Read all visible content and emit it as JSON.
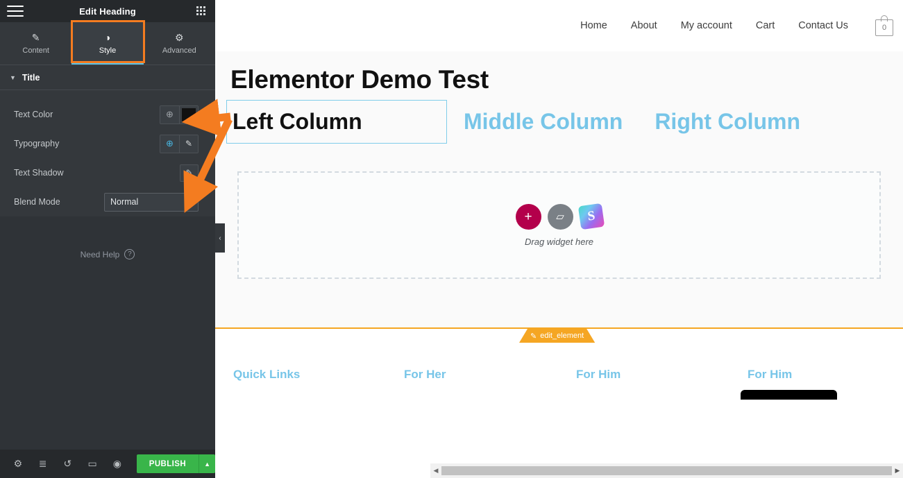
{
  "panel": {
    "header": {
      "title": "Edit Heading",
      "menu_icon": "hamburger-icon",
      "grid_icon": "widgets-grid-icon"
    },
    "tabs": [
      {
        "label": "Content",
        "icon": "pencil-icon",
        "glyph": "✎",
        "active": false
      },
      {
        "label": "Style",
        "icon": "half-circle-contrast-icon",
        "glyph": "◑",
        "active": true
      },
      {
        "label": "Advanced",
        "icon": "gear-icon",
        "glyph": "⚙",
        "active": false
      }
    ],
    "section": {
      "label": "Title",
      "caret": "▼"
    },
    "controls": [
      {
        "label": "Text Color",
        "globe": "⊕",
        "swatch_color": "#111111"
      },
      {
        "label": "Typography",
        "globe": "⊕",
        "pencil": "✎"
      },
      {
        "label": "Text Shadow",
        "pencil": "✎"
      },
      {
        "label": "Blend Mode",
        "value": "Normal",
        "caret": "▼"
      }
    ],
    "need_help": {
      "label": "Need Help",
      "badge": "?"
    },
    "footer": {
      "icons": [
        {
          "name": "settings-icon",
          "glyph": "⚙"
        },
        {
          "name": "navigator-layers-icon",
          "glyph": "≣"
        },
        {
          "name": "history-icon",
          "glyph": "↺"
        },
        {
          "name": "responsive-mode-icon",
          "glyph": "▭"
        },
        {
          "name": "preview-eye-icon",
          "glyph": "◉"
        }
      ],
      "publish_label": "PUBLISH",
      "publish_caret": "▲",
      "publish_color": "#39b54a"
    },
    "collapse_caret": "‹"
  },
  "site": {
    "nav": [
      {
        "label": "Home"
      },
      {
        "label": "About"
      },
      {
        "label": "My account"
      },
      {
        "label": "Cart"
      },
      {
        "label": "Contact Us"
      }
    ],
    "cart_count": "0",
    "heading": "Elementor Demo Test",
    "columns": [
      {
        "label": "Left Column",
        "color": "#111111",
        "selected": true
      },
      {
        "label": "Middle Column",
        "color": "#77c5e8",
        "selected": false
      },
      {
        "label": "Right Column",
        "color": "#77c5e8",
        "selected": false
      }
    ],
    "dropzone": {
      "add_glyph": "+",
      "folder_glyph": "▱",
      "slider_glyph": "S",
      "label": "Drag widget here"
    },
    "edit_tab": {
      "label": "edit_element",
      "icon": "pencil-icon",
      "glyph": "✎",
      "color": "#f5a623"
    },
    "footer_columns": [
      {
        "label": "Quick Links"
      },
      {
        "label": "For Her"
      },
      {
        "label": "For Him"
      },
      {
        "label": "For Him"
      }
    ]
  },
  "scrollbars": {
    "left_arrow": "◀",
    "right_arrow": "▶"
  },
  "annotation": {
    "color": "#f47c20",
    "type": "double-arrow"
  }
}
